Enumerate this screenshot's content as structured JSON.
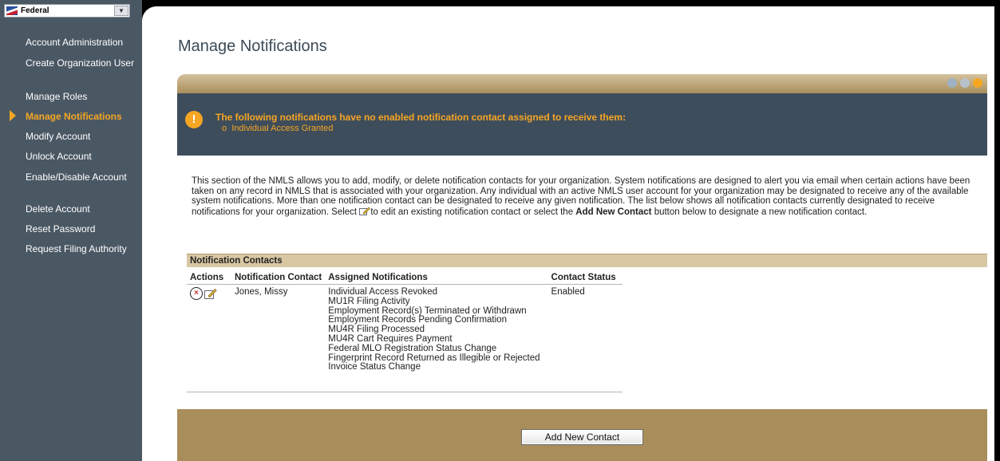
{
  "sidebar": {
    "selector": {
      "label": "Federal"
    },
    "items": [
      {
        "label": "Account Administration"
      },
      {
        "label": "Create Organization User"
      },
      {
        "label": "Manage Roles"
      },
      {
        "label": "Manage Notifications"
      },
      {
        "label": "Modify Account"
      },
      {
        "label": "Unlock Account"
      },
      {
        "label": "Enable/Disable Account"
      },
      {
        "label": "Delete Account"
      },
      {
        "label": "Reset Password"
      },
      {
        "label": "Request Filing Authority"
      }
    ],
    "active_index": 3
  },
  "page": {
    "title": "Manage Notifications"
  },
  "alert": {
    "title": "The following notifications have no enabled notification contact assigned to receive them:",
    "items": [
      "Individual Access Granted"
    ]
  },
  "description": {
    "part1": "This section of the NMLS allows you to add, modify, or delete notification contacts for your organization. System notifications are designed to alert you via email when certain actions have been taken on any record in NMLS that is associated with your organization. Any individual with an active NMLS user account for your organization may be designated to receive any of the available system notifications. More than one notification contact can be designated to receive any given notification. The list below shows all notification contacts currently designated to receive notifications for your organization. Select ",
    "part2": "to edit an existing notification contact or select the ",
    "bold": "Add New Contact",
    "part3": " button below to designate a new notification contact."
  },
  "contacts": {
    "section_title": "Notification Contacts",
    "columns": [
      "Actions",
      "Notification Contact",
      "Assigned Notifications",
      "Contact Status"
    ],
    "rows": [
      {
        "contact": "Jones, Missy",
        "notifications": [
          "Individual Access Revoked",
          "MU1R Filing Activity",
          "Employment Record(s) Terminated or Withdrawn",
          "Employment Records Pending Confirmation",
          "MU4R Filing Processed",
          "MU4R Cart Requires Payment",
          "Federal MLO Registration Status Change",
          "Fingerprint Record Returned as Illegible or Rejected",
          "Invoice Status Change"
        ],
        "status": "Enabled"
      }
    ]
  },
  "buttons": {
    "add_new_contact": "Add New Contact"
  },
  "colors": {
    "sidebar_bg": "#4a5864",
    "accent_orange": "#f6a623",
    "panel_tan": "#a98e5c",
    "alert_bg": "#3e4d5c"
  }
}
